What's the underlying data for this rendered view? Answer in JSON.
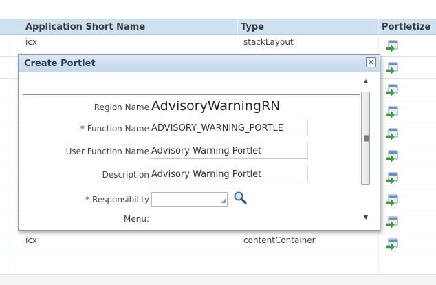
{
  "table": {
    "headers": {
      "app_short_name": "Application Short Name",
      "type": "Type",
      "portletize": "Portletize"
    },
    "rows": [
      {
        "app": "icx",
        "type": "stackLayout"
      },
      {
        "app": "",
        "type": ""
      },
      {
        "app": "",
        "type": ""
      },
      {
        "app": "",
        "type": ""
      },
      {
        "app": "",
        "type": ""
      },
      {
        "app": "",
        "type": ""
      },
      {
        "app": "",
        "type": ""
      },
      {
        "app": "",
        "type": ""
      },
      {
        "app": "",
        "type": ""
      },
      {
        "app": "icx",
        "type": "contentContainer"
      }
    ],
    "portletize_icon": "portletize-icon"
  },
  "dialog": {
    "title": "Create Portlet",
    "close_label": "✕",
    "fields": {
      "region_name_label": "Region Name",
      "region_name_value": "AdvisoryWarningRN",
      "function_name_label": "* Function Name",
      "function_name_value": "ADVISORY_WARNING_PORTLE",
      "user_function_name_label": "User Function Name",
      "user_function_name_value": "Advisory Warning Portlet",
      "description_label": "Description",
      "description_value": "Advisory Warning Portlet",
      "responsibility_label": "* Responsibility",
      "responsibility_value": "",
      "menu_label": "Menu:"
    },
    "icons": {
      "search": "search-icon",
      "scroll_up": "scroll-up-icon",
      "scroll_down": "scroll-down-icon"
    }
  }
}
